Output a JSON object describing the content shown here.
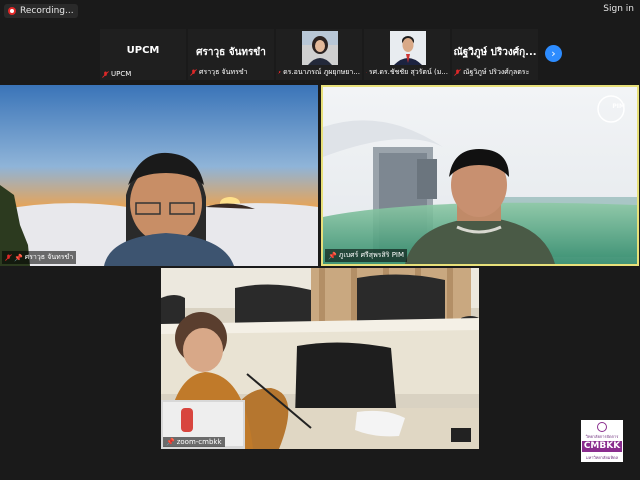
{
  "topbar": {
    "recording_label": "Recording...",
    "signin_label": "Sign in"
  },
  "strip": {
    "thumbs": [
      {
        "name": "UPCM",
        "label": "UPCM"
      },
      {
        "name": "ศราวุธ จันทรขำ",
        "label": "ศราวุธ จันทรขำ"
      },
      {
        "name": "",
        "label": "ดร.อนาภรณ์ ภูผยุกษยา..."
      },
      {
        "name": "",
        "label": "รศ.ดร.ชัชชัย สุวรัตน์ (ม..."
      },
      {
        "name": "ณัฐวิภูษ์ ปริวงศ์กุ...",
        "label": "ณัฐวิภูษ์ ปริวงศ์กุลตระ"
      }
    ]
  },
  "tiles": {
    "left": {
      "label": "ศราวุธ จันทรขำ"
    },
    "right": {
      "label": "ภูเบศร์ ศรีสุพรสิริ PIM",
      "logo_text": "PIM"
    },
    "bottom": {
      "label": "zoom-cmbkk"
    }
  },
  "watermark": {
    "top_text": "วิทยาลัยการจัดการ",
    "main_text": "CMBKK",
    "bottom_text": "มหาวิทยาลัยมหิดล"
  },
  "colors": {
    "accent": "#2d8cff",
    "active_speaker": "#e8e07a",
    "brand": "#8a2d8e"
  }
}
